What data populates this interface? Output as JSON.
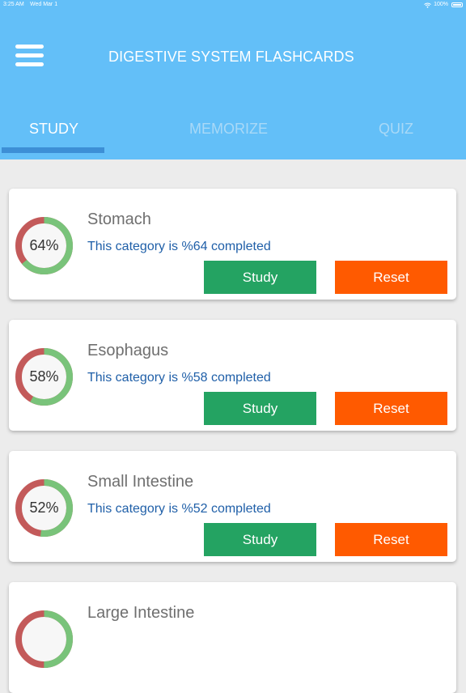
{
  "status_bar": {
    "time": "3:25 AM",
    "date": "Wed Mar 1",
    "battery": "100%"
  },
  "header": {
    "title": "DIGESTIVE SYSTEM FLASHCARDS",
    "menu_icon": "hamburger-menu-icon"
  },
  "tabs": [
    {
      "label": "STUDY",
      "active": true
    },
    {
      "label": "MEMORIZE",
      "active": false
    },
    {
      "label": "QUIZ",
      "active": false
    }
  ],
  "colors": {
    "header": "#63bff8",
    "progress_done": "#79c37a",
    "progress_remaining": "#c35a5a",
    "study_button": "#24a362",
    "reset_button": "#ff5a00",
    "status_text": "#1f5fa8"
  },
  "categories": [
    {
      "name": "Stomach",
      "percent_label": "64%",
      "progress": 64,
      "status": "This category is %64 completed",
      "study_label": "Study",
      "reset_label": "Reset"
    },
    {
      "name": "Esophagus",
      "percent_label": "58%",
      "progress": 58,
      "status": "This category is %58 completed",
      "study_label": "Study",
      "reset_label": "Reset"
    },
    {
      "name": "Small Intestine",
      "percent_label": "52%",
      "progress": 52,
      "status": "This category is %52 completed",
      "study_label": "Study",
      "reset_label": "Reset"
    },
    {
      "name": "Large Intestine",
      "percent_label": "",
      "progress": 50,
      "status": "",
      "study_label": "",
      "reset_label": ""
    }
  ]
}
